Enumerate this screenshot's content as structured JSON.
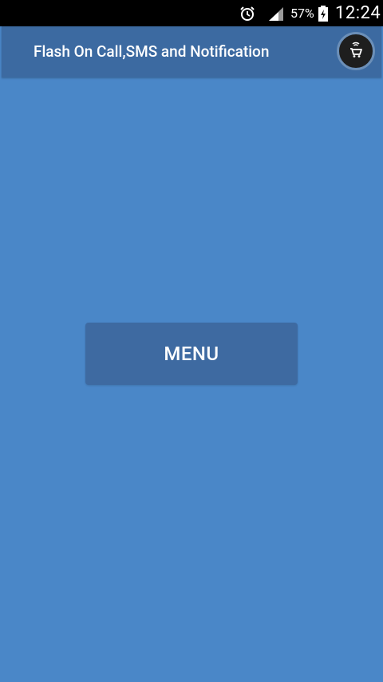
{
  "status_bar": {
    "battery_percent": "57%",
    "time": "12:24",
    "icons": [
      "alarm-icon",
      "signal-icon",
      "battery-charging-icon"
    ]
  },
  "app_bar": {
    "title": "Flash On Call,SMS and Notification",
    "action_icon": "shopping-cart-icon"
  },
  "main": {
    "menu_button_label": "MENU"
  },
  "colors": {
    "background": "#4a87c8",
    "app_bar": "#3c6aa1",
    "button": "#3e6aa1",
    "status_bar": "#000000"
  }
}
